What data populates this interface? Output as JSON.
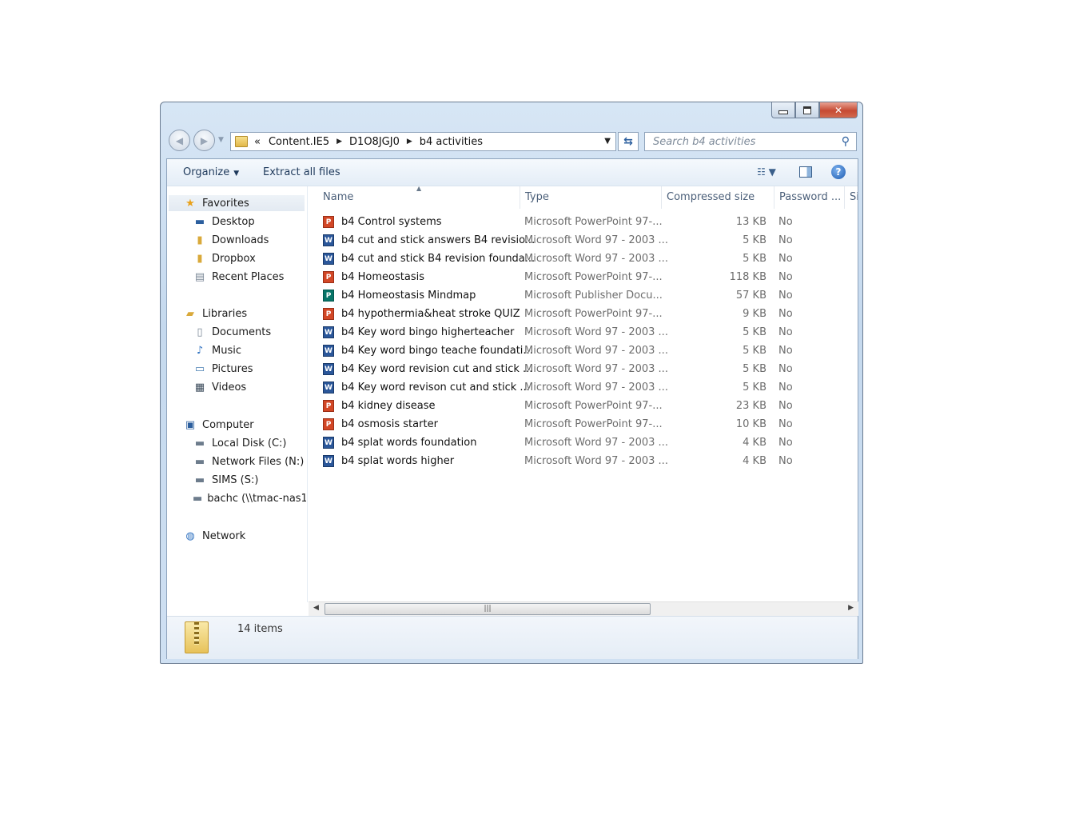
{
  "window": {
    "nav": {
      "back_icon": "back-arrow-icon",
      "forward_icon": "forward-arrow-icon"
    },
    "address": {
      "overflow": "«",
      "crumbs": [
        "Content.IE5",
        "D1O8JGJ0",
        "b4 activities"
      ]
    },
    "search": {
      "placeholder": "Search b4 activities"
    },
    "toolbar": {
      "organize": "Organize",
      "extract": "Extract all files"
    },
    "sidebar": {
      "favorites": {
        "label": "Favorites",
        "items": [
          "Desktop",
          "Downloads",
          "Dropbox",
          "Recent Places"
        ]
      },
      "libraries": {
        "label": "Libraries",
        "items": [
          "Documents",
          "Music",
          "Pictures",
          "Videos"
        ]
      },
      "computer": {
        "label": "Computer",
        "items": [
          "Local Disk (C:)",
          "Network Files (N:)",
          "SIMS (S:)",
          "bachc (\\\\tmac-nas1"
        ]
      },
      "network": {
        "label": "Network"
      }
    },
    "columns": {
      "name": "Name",
      "type": "Type",
      "size": "Compressed size",
      "password": "Password ...",
      "extra": "Si"
    },
    "files": [
      {
        "name": "b4 Control systems",
        "type": "Microsoft PowerPoint 97-...",
        "size": "13 KB",
        "pw": "No",
        "kind": "ppt"
      },
      {
        "name": "b4 cut and stick answers B4 revisio...",
        "type": "Microsoft Word 97 - 2003 ...",
        "size": "5 KB",
        "pw": "No",
        "kind": "doc"
      },
      {
        "name": "b4 cut and stick B4 revision founda...",
        "type": "Microsoft Word 97 - 2003 ...",
        "size": "5 KB",
        "pw": "No",
        "kind": "doc"
      },
      {
        "name": "b4 Homeostasis",
        "type": "Microsoft PowerPoint 97-...",
        "size": "118 KB",
        "pw": "No",
        "kind": "ppt"
      },
      {
        "name": "b4 Homeostasis Mindmap",
        "type": "Microsoft Publisher Docu...",
        "size": "57 KB",
        "pw": "No",
        "kind": "pub"
      },
      {
        "name": "b4 hypothermia&heat stroke QUIZ",
        "type": "Microsoft PowerPoint 97-...",
        "size": "9 KB",
        "pw": "No",
        "kind": "ppt"
      },
      {
        "name": "b4 Key word bingo higherteacher",
        "type": "Microsoft Word 97 - 2003 ...",
        "size": "5 KB",
        "pw": "No",
        "kind": "doc"
      },
      {
        "name": "b4 Key word bingo teache foundati...",
        "type": "Microsoft Word 97 - 2003 ...",
        "size": "5 KB",
        "pw": "No",
        "kind": "doc"
      },
      {
        "name": "b4 Key word revision cut and stick ...",
        "type": "Microsoft Word 97 - 2003 ...",
        "size": "5 KB",
        "pw": "No",
        "kind": "doc"
      },
      {
        "name": "b4 Key word revison cut and stick ...",
        "type": "Microsoft Word 97 - 2003 ...",
        "size": "5 KB",
        "pw": "No",
        "kind": "doc"
      },
      {
        "name": "b4 kidney disease",
        "type": "Microsoft PowerPoint 97-...",
        "size": "23 KB",
        "pw": "No",
        "kind": "ppt"
      },
      {
        "name": "b4 osmosis starter",
        "type": "Microsoft PowerPoint 97-...",
        "size": "10 KB",
        "pw": "No",
        "kind": "ppt"
      },
      {
        "name": "b4 splat words foundation",
        "type": "Microsoft Word 97 - 2003 ...",
        "size": "4 KB",
        "pw": "No",
        "kind": "doc"
      },
      {
        "name": "b4 splat words higher",
        "type": "Microsoft Word 97 - 2003 ...",
        "size": "4 KB",
        "pw": "No",
        "kind": "doc"
      }
    ],
    "status": {
      "count": "14 items"
    }
  }
}
